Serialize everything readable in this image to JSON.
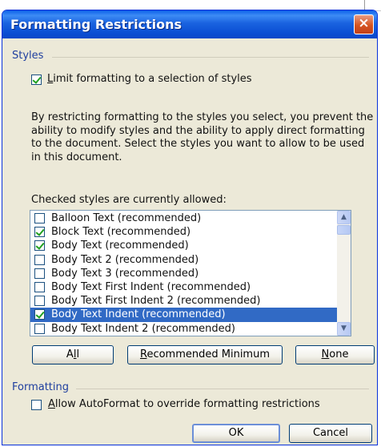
{
  "window": {
    "title": "Formatting Restrictions"
  },
  "styles_section": {
    "label": "Styles",
    "limit_checkbox": {
      "checked": true,
      "label_prefix": "L",
      "label_rest": "imit formatting to a selection of styles"
    },
    "description": "By restricting formatting to the styles you select, you prevent the ability to modify styles and the ability to apply direct formatting to the document. Select the styles you want to allow to be used in this document.",
    "list_caption": "Checked styles are currently allowed:",
    "items": [
      {
        "label": "Balloon Text (recommended)",
        "checked": false,
        "selected": false
      },
      {
        "label": "Block Text (recommended)",
        "checked": true,
        "selected": false
      },
      {
        "label": "Body Text (recommended)",
        "checked": true,
        "selected": false
      },
      {
        "label": "Body Text 2 (recommended)",
        "checked": false,
        "selected": false
      },
      {
        "label": "Body Text 3 (recommended)",
        "checked": false,
        "selected": false
      },
      {
        "label": "Body Text First Indent (recommended)",
        "checked": false,
        "selected": false
      },
      {
        "label": "Body Text First Indent 2 (recommended)",
        "checked": false,
        "selected": false
      },
      {
        "label": "Body Text Indent (recommended)",
        "checked": true,
        "selected": true
      },
      {
        "label": "Body Text Indent 2 (recommended)",
        "checked": false,
        "selected": false
      }
    ],
    "buttons": {
      "all": {
        "pre": "A",
        "u": "l",
        "post": "l"
      },
      "recommended": {
        "u": "R",
        "post": "ecommended Minimum"
      },
      "none": {
        "u": "N",
        "post": "one"
      }
    }
  },
  "formatting_section": {
    "label": "Formatting",
    "autoformat_checkbox": {
      "checked": false,
      "u": "A",
      "label_rest": "llow AutoFormat to override formatting restrictions"
    }
  },
  "footer": {
    "ok_label": "OK",
    "cancel_label": "Cancel"
  },
  "scrollbar": {
    "up_glyph": "▲",
    "down_glyph": "▼"
  },
  "icons": {
    "close": "×"
  },
  "colors": {
    "title_bar": "#0b4fd4",
    "selection": "#316ac5",
    "dialog_bg": "#ece9d8",
    "check": "#21a121"
  }
}
